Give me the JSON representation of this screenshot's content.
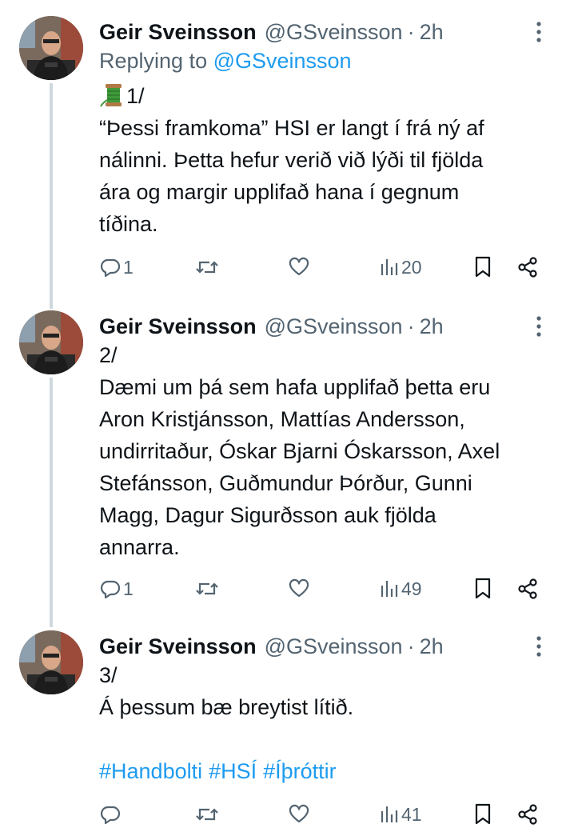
{
  "tweets": [
    {
      "name": "Geir Sveinsson",
      "handle": "@GSveinsson",
      "time": "2h",
      "reply_prefix": "Replying to ",
      "reply_to": "@GSveinsson",
      "lines": [
        "1/",
        "“Þessi framkoma” HSI er langt í frá ný af",
        "nálinni. Þetta hefur verið við lýði til fjölda",
        "ára og margir upplifað hana í gegnum",
        "tíðina."
      ],
      "stats": {
        "replies": "1",
        "reposts": "",
        "likes": "",
        "views": "20"
      }
    },
    {
      "name": "Geir Sveinsson",
      "handle": "@GSveinsson",
      "time": "2h",
      "lines": [
        "2/",
        "Dæmi um þá sem hafa upplifað þetta eru",
        "Aron Kristjánsson, Mattías Andersson,",
        "undirritaður, Óskar Bjarni Óskarsson, Axel",
        "Stefánsson, Guðmundur Þórður, Gunni",
        "Magg, Dagur Sigurðsson auk fjölda",
        "annarra."
      ],
      "stats": {
        "replies": "1",
        "reposts": "",
        "likes": "",
        "views": "49"
      }
    },
    {
      "name": "Geir Sveinsson",
      "handle": "@GSveinsson",
      "time": "2h",
      "lines": [
        "3/",
        "Á þessum bæ breytist lítið."
      ],
      "hashtags": [
        "#Handbolti",
        "#HSÍ",
        "#Íþróttir"
      ],
      "stats": {
        "replies": "",
        "reposts": "",
        "likes": "",
        "views": "41"
      }
    }
  ],
  "icons": {
    "emoji": "spool-of-thread-icon",
    "more": "more-icon",
    "reply": "reply-icon",
    "repost": "repost-icon",
    "like": "heart-icon",
    "views": "views-icon",
    "bookmark": "bookmark-icon",
    "share": "share-icon"
  },
  "colors": {
    "text": "#0f1419",
    "secondary": "#536471",
    "link": "#1d9bf0",
    "thread_line": "#cfd9de"
  }
}
